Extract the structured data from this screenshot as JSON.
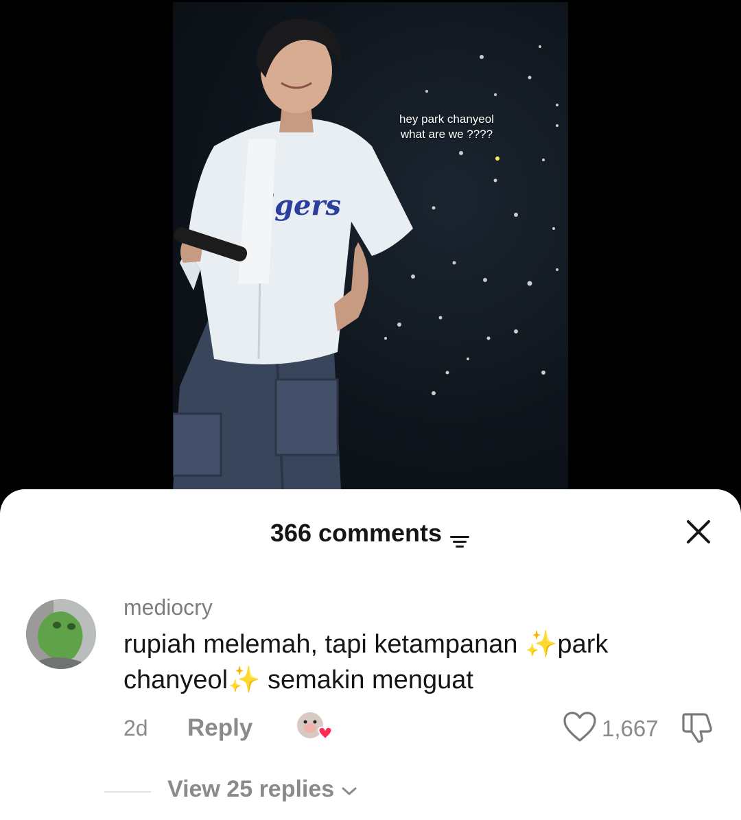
{
  "video": {
    "overlay_caption": "hey park chanyeol\nwhat are we ????",
    "jersey_text": "dgers"
  },
  "comments_sheet": {
    "title": "366 comments",
    "filter_icon": "filter-icon",
    "close_icon": "close-icon",
    "comment": {
      "username": "mediocry",
      "text": "rupiah melemah, tapi ketampanan ✨park chanyeol✨ semakin menguat",
      "timestamp": "2d",
      "reply_label": "Reply",
      "like_count": "1,667",
      "view_replies_label": "View 25 replies"
    }
  },
  "colors": {
    "sheet_bg": "#ffffff",
    "primary_text": "#161616",
    "secondary_text": "#8a8a8a",
    "creator_heart": "#fe2c55"
  }
}
